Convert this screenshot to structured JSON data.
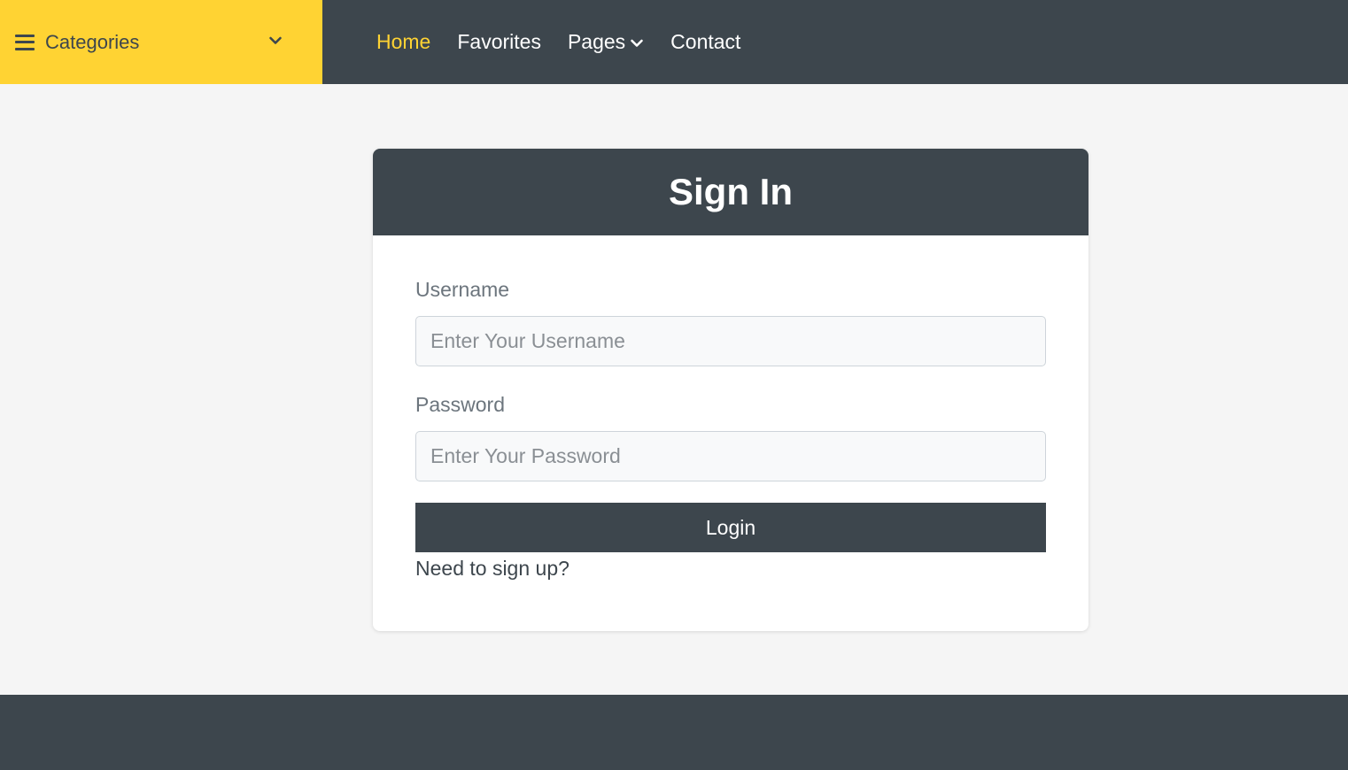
{
  "header": {
    "categories_label": "Categories",
    "categories_icon": "bars-icon",
    "nav": [
      {
        "label": "Home",
        "active": true
      },
      {
        "label": "Favorites",
        "active": false
      },
      {
        "label": "Pages",
        "active": false,
        "has_dropdown": true
      },
      {
        "label": "Contact",
        "active": false
      }
    ]
  },
  "signin": {
    "title": "Sign In",
    "username_label": "Username",
    "username_placeholder": "Enter Your Username",
    "password_label": "Password",
    "password_placeholder": "Enter Your Password",
    "login_label": "Login",
    "signup_link": "Need to sign up?"
  },
  "colors": {
    "accent": "#ffd333",
    "dark": "#3d464d",
    "background": "#f5f5f5"
  }
}
